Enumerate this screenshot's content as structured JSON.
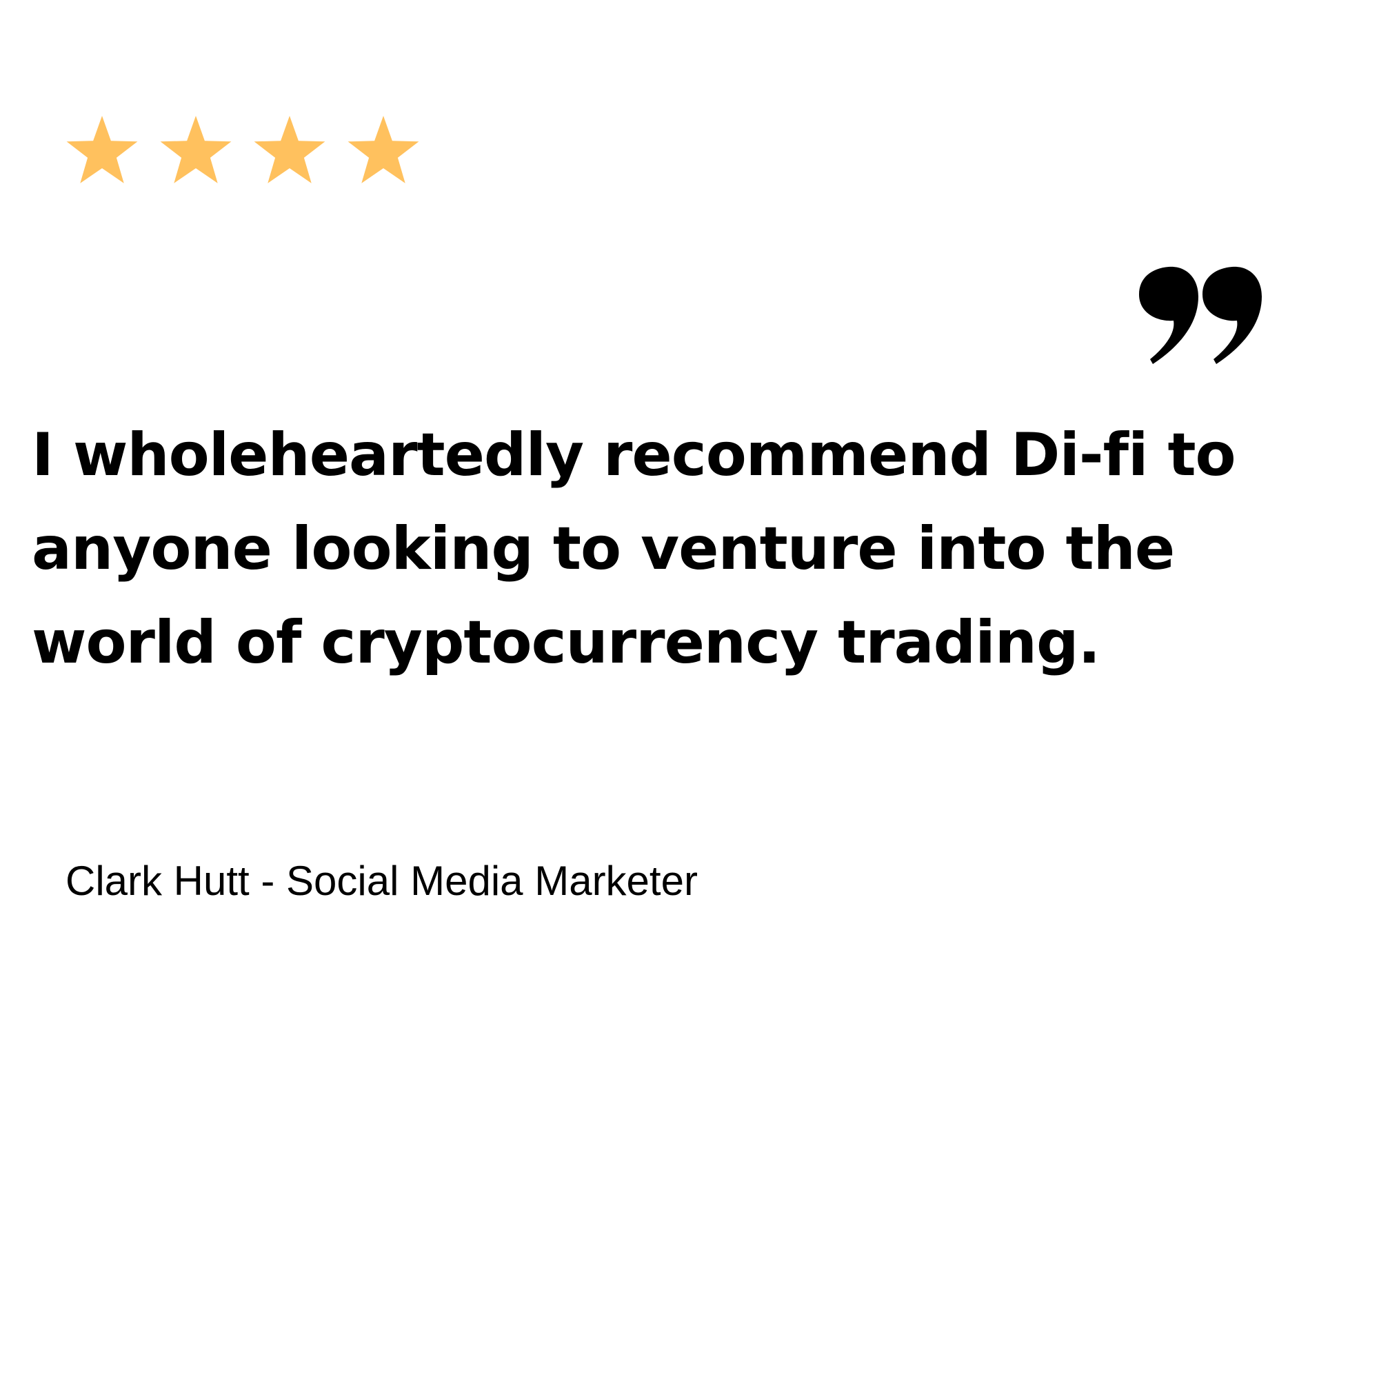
{
  "review": {
    "rating": {
      "value": 4,
      "icon": "star-icon",
      "color": "#FFC15E"
    },
    "quote_icon": "closing-quote-icon",
    "quote_color": "#000000",
    "text": "I wholeheartedly recommend Di-fi to anyone looking to venture into the world of cryptocurrency trading.",
    "author": "Clark Hutt - Social Media Marketer"
  }
}
